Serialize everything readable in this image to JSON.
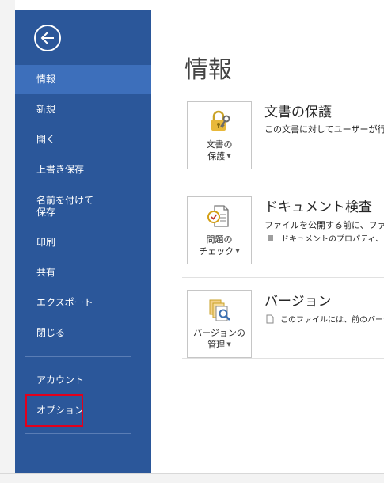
{
  "sidebar": {
    "items": [
      {
        "label": "情報"
      },
      {
        "label": "新規"
      },
      {
        "label": "開く"
      },
      {
        "label": "上書き保存"
      },
      {
        "label": "名前を付けて\n保存"
      },
      {
        "label": "印刷"
      },
      {
        "label": "共有"
      },
      {
        "label": "エクスポート"
      },
      {
        "label": "閉じる"
      },
      {
        "label": "アカウント"
      },
      {
        "label": "オプション"
      }
    ],
    "active_index": 0,
    "highlighted_item": "オプション"
  },
  "main": {
    "title": "情報",
    "sections": [
      {
        "button_label": "文書の\n保護",
        "icon": "lock-key-icon",
        "title": "文書の保護",
        "description": "この文書に対してユーザーが行え"
      },
      {
        "button_label": "問題の\nチェック",
        "icon": "document-check-icon",
        "title": "ドキュメント検査",
        "description": "ファイルを公開する前に、ファイ",
        "bullet": "ドキュメントのプロパティ、作"
      },
      {
        "button_label": "バージョンの\n管理",
        "icon": "version-manage-icon",
        "title": "バージョン",
        "bullet": "このファイルには、前のバージョ"
      }
    ]
  },
  "colors": {
    "sidebar_bg": "#2b579a",
    "active_item_bg": "#3d6fbb",
    "highlight_border": "#e3001b"
  }
}
